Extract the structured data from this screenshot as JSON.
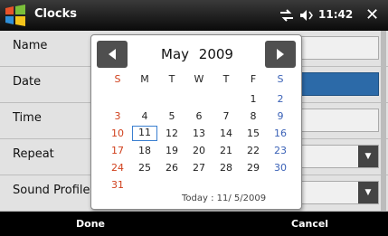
{
  "titlebar": {
    "app_title": "Clocks",
    "time": "11:42",
    "close": "✕"
  },
  "form": {
    "rows": [
      {
        "label": "Name"
      },
      {
        "label": "Date"
      },
      {
        "label": "Time"
      },
      {
        "label": "Repeat"
      },
      {
        "label": "Sound Profile"
      }
    ]
  },
  "softkeys": {
    "left": "Done",
    "right": "Cancel"
  },
  "calendar": {
    "month": "May",
    "year": "2009",
    "weekdays": [
      "S",
      "M",
      "T",
      "W",
      "T",
      "F",
      "S"
    ],
    "weeks": [
      [
        "",
        "",
        "",
        "",
        "",
        "1",
        "2"
      ],
      [
        "3",
        "4",
        "5",
        "6",
        "7",
        "8",
        "9"
      ],
      [
        "10",
        "11",
        "12",
        "13",
        "14",
        "15",
        "16"
      ],
      [
        "17",
        "18",
        "19",
        "20",
        "21",
        "22",
        "23"
      ],
      [
        "24",
        "25",
        "26",
        "27",
        "28",
        "29",
        "30"
      ],
      [
        "31",
        "",
        "",
        "",
        "",
        "",
        ""
      ]
    ],
    "selected_day": "11",
    "today_text": "Today : 11/ 5/2009"
  },
  "colors": {
    "sunday": "#d0401c",
    "saturday": "#3b62b7",
    "selection": "#3a7fd0"
  }
}
